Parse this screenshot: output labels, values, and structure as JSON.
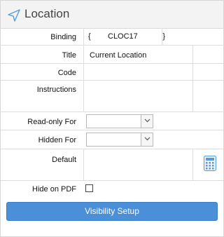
{
  "header": {
    "title": "Location",
    "icon": "location-arrow-icon"
  },
  "fields": {
    "binding": {
      "label": "Binding",
      "open_brace": "{",
      "value": "CLOC17",
      "close_brace": "}"
    },
    "title": {
      "label": "Title",
      "value": "Current Location"
    },
    "code": {
      "label": "Code",
      "value": ""
    },
    "instructions": {
      "label": "Instructions",
      "value": ""
    },
    "readonly_for": {
      "label": "Read-only For",
      "value": ""
    },
    "hidden_for": {
      "label": "Hidden For",
      "value": ""
    },
    "default": {
      "label": "Default",
      "value": "",
      "icon": "calculator-icon"
    },
    "hide_on_pdf": {
      "label": "Hide on PDF",
      "checked": false
    }
  },
  "buttons": {
    "visibility_setup": "Visibility Setup"
  },
  "colors": {
    "accent": "#4a8fd8",
    "icon_blue": "#5b9bd5"
  }
}
